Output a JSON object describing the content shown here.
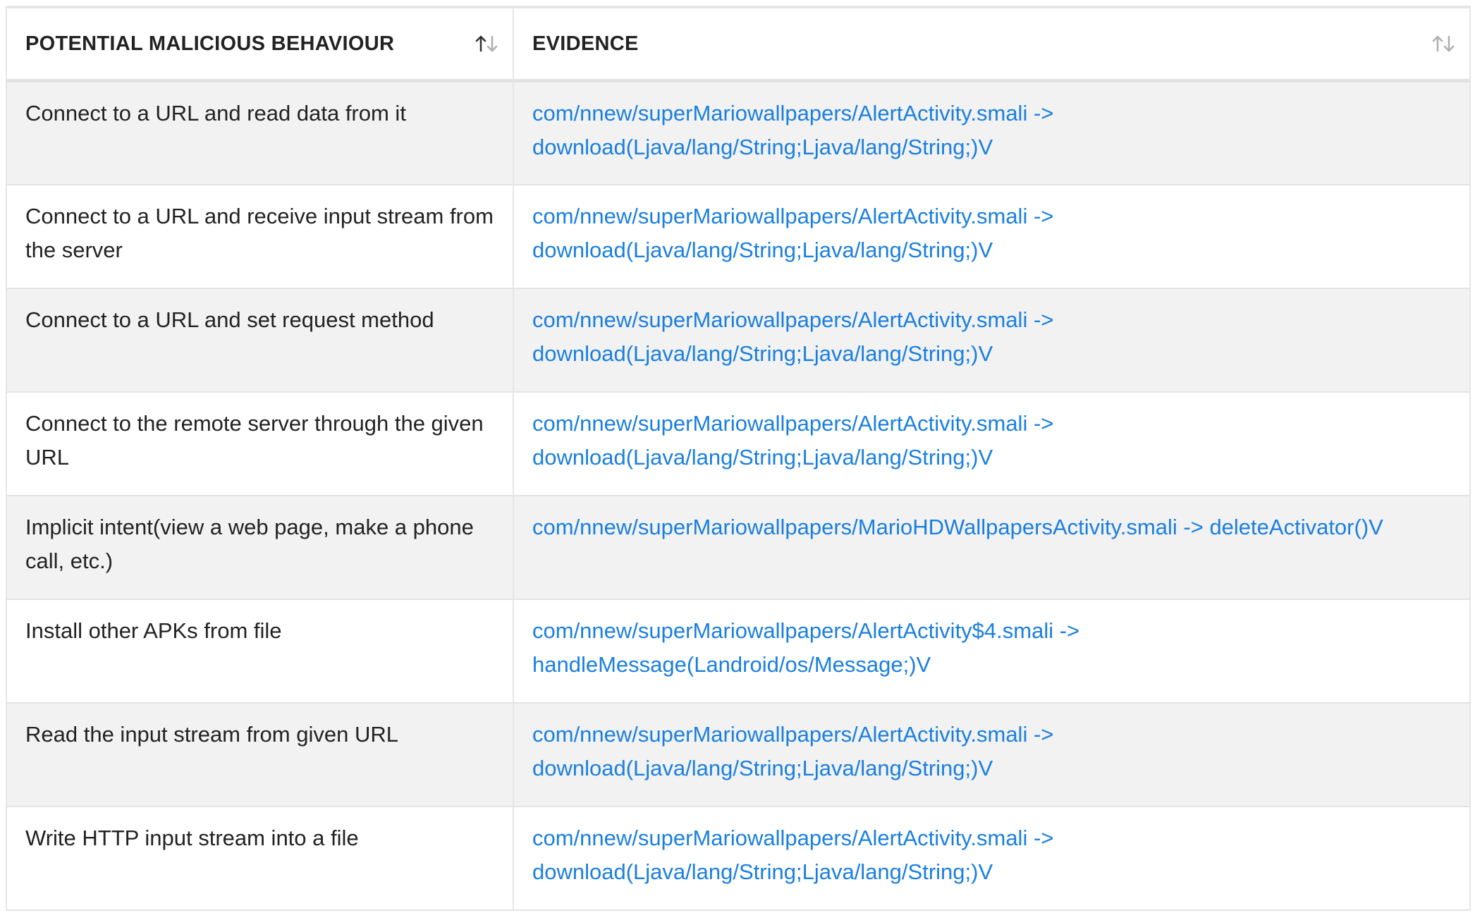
{
  "table": {
    "headers": [
      {
        "label": "POTENTIAL MALICIOUS BEHAVIOUR",
        "sort_state": "sorted"
      },
      {
        "label": "EVIDENCE",
        "sort_state": "unsorted"
      }
    ],
    "rows": [
      {
        "behaviour": "Connect to a URL and read data from it",
        "evidence": [
          "com/nnew/superMariowallpapers/AlertActivity.smali ->",
          "download(Ljava/lang/String;Ljava/lang/String;)V"
        ]
      },
      {
        "behaviour": "Connect to a URL and receive input stream from the server",
        "evidence": [
          "com/nnew/superMariowallpapers/AlertActivity.smali ->",
          "download(Ljava/lang/String;Ljava/lang/String;)V"
        ]
      },
      {
        "behaviour": "Connect to a URL and set request method",
        "evidence": [
          "com/nnew/superMariowallpapers/AlertActivity.smali ->",
          "download(Ljava/lang/String;Ljava/lang/String;)V"
        ]
      },
      {
        "behaviour": "Connect to the remote server through the given URL",
        "evidence": [
          "com/nnew/superMariowallpapers/AlertActivity.smali ->",
          "download(Ljava/lang/String;Ljava/lang/String;)V"
        ]
      },
      {
        "behaviour": "Implicit intent(view a web page, make a phone call, etc.)",
        "evidence": [
          "com/nnew/superMariowallpapers/MarioHDWallpapersActivity.smali -> deleteActivator()V",
          ""
        ]
      },
      {
        "behaviour": "Install other APKs from file",
        "evidence": [
          "com/nnew/superMariowallpapers/AlertActivity$4.smali ->",
          "handleMessage(Landroid/os/Message;)V"
        ]
      },
      {
        "behaviour": "Read the input stream from given URL",
        "evidence": [
          "com/nnew/superMariowallpapers/AlertActivity.smali ->",
          "download(Ljava/lang/String;Ljava/lang/String;)V"
        ]
      },
      {
        "behaviour": "Write HTTP input stream into a file",
        "evidence": [
          "com/nnew/superMariowallpapers/AlertActivity.smali ->",
          "download(Ljava/lang/String;Ljava/lang/String;)V"
        ]
      }
    ]
  },
  "icons": {
    "sort_active": "sort-arrows-icon",
    "sort_inactive": "sort-arrows-icon",
    "colors": {
      "sort_active": "#333333",
      "sort_inactive": "#b0b0b0",
      "link": "#1a7fe0",
      "stripe": "#f2f2f2"
    }
  }
}
